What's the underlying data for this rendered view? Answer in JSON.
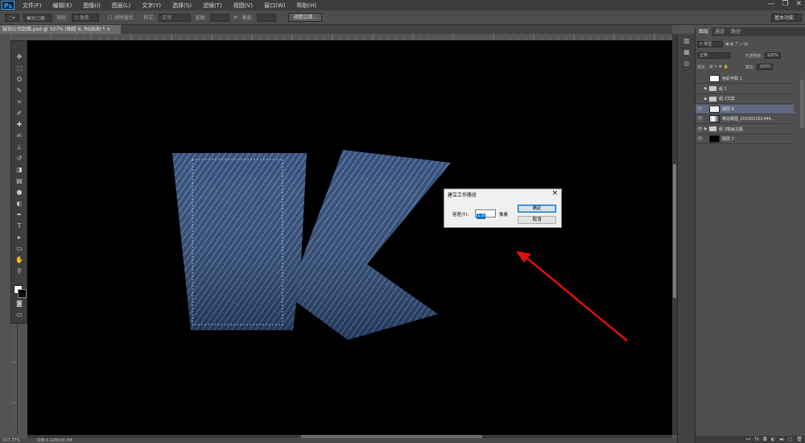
{
  "app": {
    "logo": "Ps"
  },
  "menu": [
    "文件(F)",
    "编辑(E)",
    "图像(I)",
    "图层(L)",
    "文字(Y)",
    "选择(S)",
    "滤镜(T)",
    "视图(V)",
    "窗口(W)",
    "帮助(H)"
  ],
  "window_controls": {
    "minimize": "—",
    "restore": "❐",
    "close": "✕"
  },
  "options_bar": {
    "feather_label": "羽化:",
    "feather_value": "0 像素",
    "antialias_label": "消除锯齿",
    "style_label": "样式:",
    "style_value": "正常",
    "width_label": "宽度:",
    "height_label": "高度:",
    "refine_button": "调整边缘...",
    "workspace": "基本功能"
  },
  "document_tab": {
    "title": "装饰公司封面.psd @ 107% (图层 6, RGB/8) *",
    "close": "×"
  },
  "toolbar_icons": [
    "move-icon",
    "marquee-icon",
    "lasso-icon",
    "quick-select-icon",
    "crop-icon",
    "eyedropper-icon",
    "healing-icon",
    "brush-icon",
    "stamp-icon",
    "history-brush-icon",
    "eraser-icon",
    "gradient-icon",
    "blur-icon",
    "dodge-icon",
    "pen-icon",
    "type-icon",
    "path-select-icon",
    "shape-icon",
    "hand-icon",
    "zoom-icon"
  ],
  "toolbar_glyphs": [
    "✥",
    "⬚",
    "ʘ",
    "✎",
    "⌗",
    "✐",
    "✚",
    "✍",
    "⊥",
    "↺",
    "◨",
    "▤",
    "●",
    "◐",
    "✒",
    "T",
    "▸",
    "▭",
    "✋",
    "⚲"
  ],
  "status_bar": {
    "zoom": "107.37%",
    "doc": "文档:4.12M/34.3M"
  },
  "panel": {
    "tabs": [
      "图层",
      "通道",
      "路径"
    ],
    "kind_label": "类型",
    "blend_mode": "正常",
    "opacity_label": "不透明度:",
    "opacity_value": "100%",
    "lock_label": "锁定:",
    "fill_label": "填充:",
    "fill_value": "100%"
  },
  "layers": [
    {
      "name": "色彩平衡 1",
      "type": "adjustment",
      "visible": false,
      "selected": false
    },
    {
      "name": "组 1",
      "type": "group",
      "visible": false,
      "selected": false
    },
    {
      "name": "组 2文案",
      "type": "group",
      "visible": false,
      "selected": false
    },
    {
      "name": "图层 6",
      "type": "layer",
      "visible": true,
      "selected": true
    },
    {
      "name": "微信截图_202302181444...",
      "type": "image",
      "visible": true,
      "selected": false
    },
    {
      "name": "组 3笔画主图",
      "type": "group",
      "visible": true,
      "selected": false
    },
    {
      "name": "图层 7",
      "type": "layer",
      "visible": true,
      "selected": false
    }
  ],
  "dialog": {
    "title": "建立工作路径",
    "tolerance_label": "容差(T):",
    "tolerance_value": "1.0",
    "unit": "像素",
    "ok": "确定",
    "cancel": "取消"
  },
  "colors": {
    "denim": "#3d5a8a",
    "arrow": "#e01010",
    "selection": "#5f6a80"
  }
}
